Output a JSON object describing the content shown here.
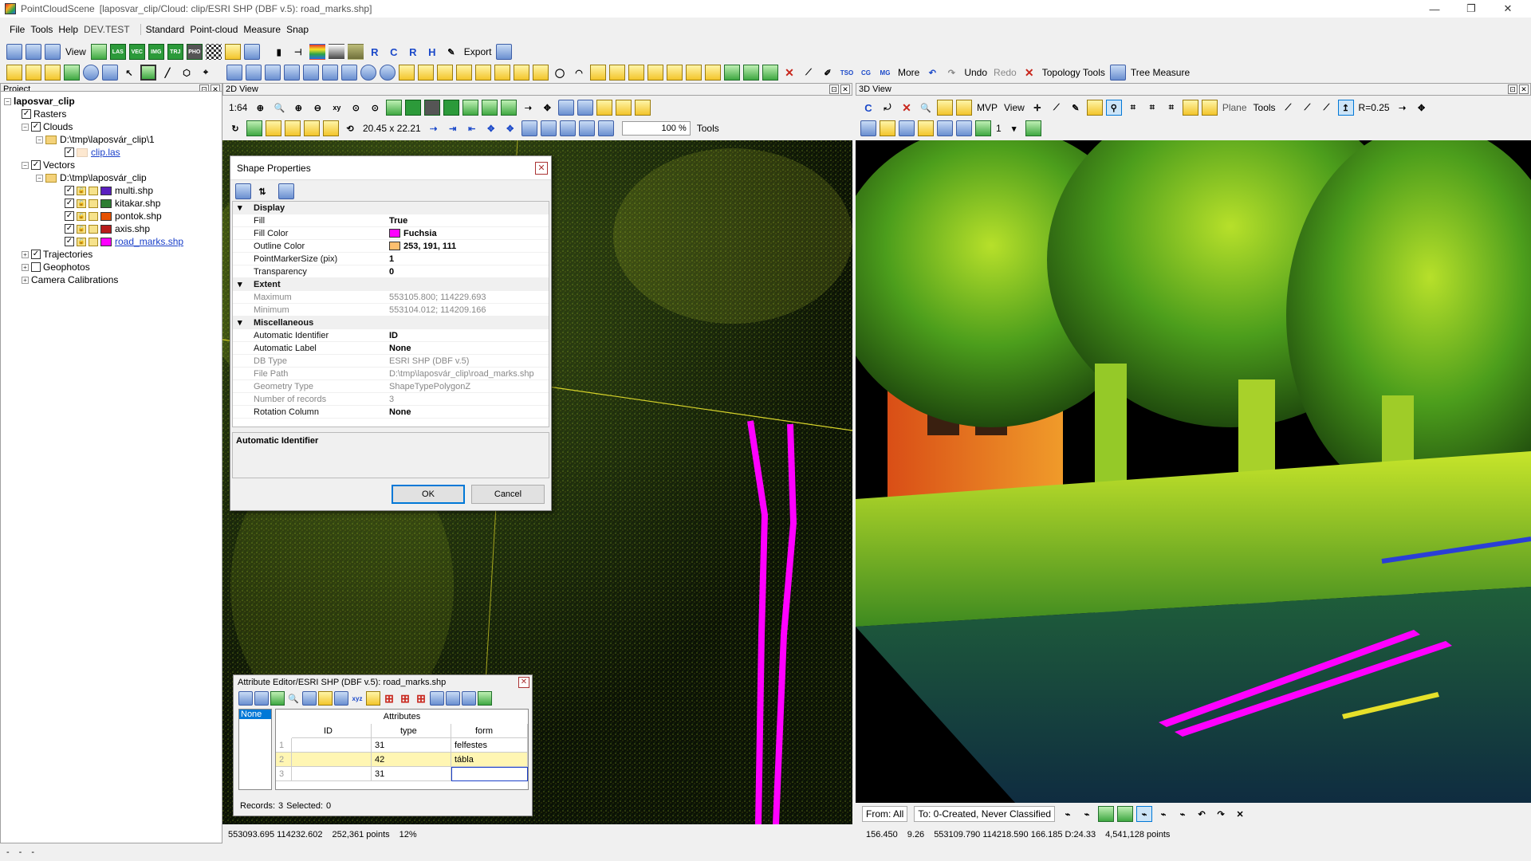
{
  "window": {
    "app_name": "PointCloudScene",
    "title": "[laposvar_clip/Cloud: clip/ESRI SHP (DBF v.5): road_marks.shp]",
    "minimize": "—",
    "maximize": "❐",
    "close": "✕"
  },
  "menu": {
    "file": "File",
    "tools": "Tools",
    "help": "Help",
    "dev": "DEV.TEST",
    "standard": "Standard",
    "pointcloud": "Point-cloud",
    "measure": "Measure",
    "snap": "Snap"
  },
  "toolbar1": {
    "view_label": "View",
    "las": "LAS",
    "vec": "VEC",
    "img": "IMG",
    "trj": "TRJ",
    "pho": "PHO",
    "r1": "R",
    "c": "C",
    "r2": "R",
    "h": "H",
    "export_label": "Export"
  },
  "toolbar2": {
    "tso": "TSO",
    "cg": "CG",
    "mg": "MG",
    "more_label": "More",
    "undo_label": "Undo",
    "redo_label": "Redo",
    "topology_label": "Topology Tools",
    "tree_measure_label": "Tree Measure"
  },
  "project": {
    "header": "Project",
    "root": "laposvar_clip",
    "rasters": "Rasters",
    "clouds": "Clouds",
    "clouds_path": "D:\\tmp\\laposvár_clip\\1",
    "clip_file": "clip.las",
    "vectors": "Vectors",
    "vectors_path": "D:\\tmp\\laposvár_clip",
    "files": [
      {
        "name": "multi.shp",
        "color": "#5a1fbf"
      },
      {
        "name": "kitakar.shp",
        "color": "#2e7d32"
      },
      {
        "name": "pontok.shp",
        "color": "#e65100"
      },
      {
        "name": "axis.shp",
        "color": "#b71c1c"
      },
      {
        "name": "road_marks.shp",
        "color": "#ff00ff"
      }
    ],
    "trajectories": "Trajectories",
    "geophotos": "Geophotos",
    "camera_calibrations": "Camera Calibrations"
  },
  "view2d": {
    "header": "2D View",
    "scale": "1:64",
    "size_readout": "20.45 x 22.21",
    "zoom": "100 %",
    "tools_label": "Tools",
    "status_coords": "553093.695 114232.602",
    "status_points": "252,361 points",
    "status_pct": "12%"
  },
  "view3d": {
    "header": "3D View",
    "c": "C",
    "mvp_label": "MVP",
    "view_label": "View",
    "plane_label": "Plane",
    "tools_label": "Tools",
    "radius": "R=0.25",
    "level": "1",
    "from_label": "From: All",
    "to_label": "To: 0-Created, Never Classified",
    "status_a": "156.450",
    "status_b": "9.26",
    "status_coords": "553109.790 114218.590 166.185 D:24.33",
    "status_points": "4,541,128 points"
  },
  "dialog": {
    "title": "Shape Properties",
    "cat_display": "Display",
    "fill_name": "Fill",
    "fill_value": "True",
    "fill_color_name": "Fill Color",
    "fill_color_value": "Fuchsia",
    "fill_color_hex": "#ff00ff",
    "outline_color_name": "Outline Color",
    "outline_color_value": "253, 191, 111",
    "outline_color_hex": "#fdbf6f",
    "marker_size_name": "PointMarkerSize (pix)",
    "marker_size_value": "1",
    "transparency_name": "Transparency",
    "transparency_value": "0",
    "cat_extent": "Extent",
    "maximum_name": "Maximum",
    "maximum_value": "553105.800; 114229.693",
    "minimum_name": "Minimum",
    "minimum_value": "553104.012; 114209.166",
    "cat_misc": "Miscellaneous",
    "auto_id_name": "Automatic Identifier",
    "auto_id_value": "ID",
    "auto_label_name": "Automatic Label",
    "auto_label_value": "None",
    "db_type_name": "DB Type",
    "db_type_value": "ESRI SHP (DBF v.5)",
    "file_path_name": "File Path",
    "file_path_value": "D:\\tmp\\laposvár_clip\\road_marks.shp",
    "geometry_name": "Geometry Type",
    "geometry_value": "ShapeTypePolygonZ",
    "records_name": "Number of records",
    "records_value": "3",
    "rotation_name": "Rotation Column",
    "rotation_value": "None",
    "description_title": "Automatic Identifier",
    "ok": "OK",
    "cancel": "Cancel"
  },
  "attr_editor": {
    "title": "Attribute Editor/ESRI SHP (DBF v.5): road_marks.shp",
    "none_label": "None",
    "attributes_header": "Attributes",
    "columns": [
      "ID",
      "type",
      "form"
    ],
    "rows": [
      {
        "n": "1",
        "id": "31",
        "type": "felfestes"
      },
      {
        "n": "2",
        "id": "42",
        "type": "tábla"
      },
      {
        "n": "3",
        "id": "31",
        "type": ""
      }
    ],
    "records_label": "Records:",
    "records_value": "3",
    "selected_label": "Selected:",
    "selected_value": "0"
  },
  "bottom": {
    "a": "-",
    "b": "-",
    "c": "-"
  }
}
